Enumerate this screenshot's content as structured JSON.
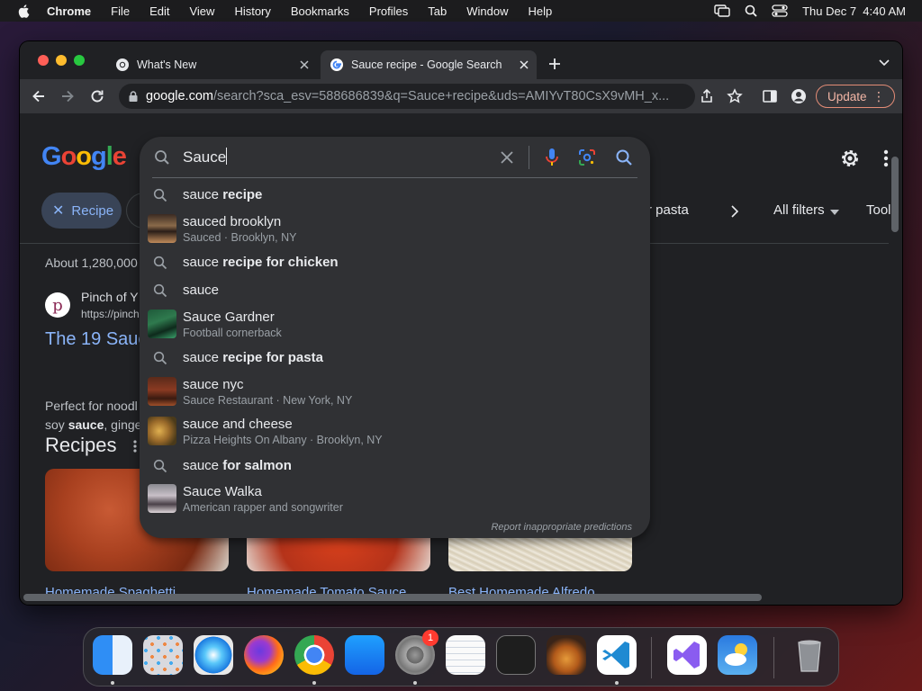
{
  "menubar": {
    "app": "Chrome",
    "items": [
      "File",
      "Edit",
      "View",
      "History",
      "Bookmarks",
      "Profiles",
      "Tab",
      "Window",
      "Help"
    ],
    "clock": "Thu Dec 7  4:40 AM"
  },
  "tabs": [
    {
      "title": "What's New",
      "active": false
    },
    {
      "title": "Sauce recipe - Google Search",
      "active": true
    }
  ],
  "omnibox": {
    "host": "google.com",
    "path": "/search?sca_esv=588686839&q=Sauce+recipe&uds=AMIYvT80CsX9vMH_x..."
  },
  "update_button": "Update",
  "page": {
    "logo": [
      "G",
      "o",
      "o",
      "g",
      "l",
      "e"
    ],
    "logo_colors": [
      "#4285f4",
      "#ea4335",
      "#fbbc05",
      "#4285f4",
      "#34a853",
      "#ea4335"
    ],
    "chip_recipe": "Recipe",
    "filter_partial": "r pasta",
    "all_filters": "All filters",
    "tools_partial": "Tool",
    "about": "About 1,280,000",
    "site_letter": "p",
    "site_name": "Pinch of Y",
    "site_url": "https://pinch",
    "result_title": "The 19 Sauc",
    "snippet_line1": "Perfect for noodl",
    "snippet_line2_a": "soy ",
    "snippet_line2_b": "sauce",
    "snippet_line2_c": ", ginge",
    "recipes_heading": "Recipes",
    "cards": [
      {
        "title": "Homemade Spaghetti"
      },
      {
        "title": "Homemade Tomato Sauce"
      },
      {
        "title": "Best Homemade Alfredo"
      }
    ]
  },
  "search": {
    "query": "Sauce",
    "suggestions": [
      {
        "kind": "query",
        "prefix": "sauce ",
        "bold": "recipe",
        "sub": ""
      },
      {
        "kind": "entity",
        "prefix": "sauced brooklyn",
        "bold": "",
        "sub": "Sauced · Brooklyn, NY"
      },
      {
        "kind": "query",
        "prefix": "sauce ",
        "bold": "recipe for chicken",
        "sub": ""
      },
      {
        "kind": "query",
        "prefix": "sauce",
        "bold": "",
        "sub": ""
      },
      {
        "kind": "entity",
        "prefix": "Sauce Gardner",
        "bold": "",
        "sub": "Football cornerback"
      },
      {
        "kind": "query",
        "prefix": "sauce ",
        "bold": "recipe for pasta",
        "sub": ""
      },
      {
        "kind": "entity",
        "prefix": "sauce nyc",
        "bold": "",
        "sub": "Sauce Restaurant · New York, NY"
      },
      {
        "kind": "entity",
        "prefix": "sauce and cheese",
        "bold": "",
        "sub": "Pizza Heights On Albany · Brooklyn, NY"
      },
      {
        "kind": "query",
        "prefix": "sauce ",
        "bold": "for salmon",
        "sub": ""
      },
      {
        "kind": "entity",
        "prefix": "Sauce Walka",
        "bold": "",
        "sub": "American rapper and songwriter"
      }
    ],
    "report": "Report inappropriate predictions"
  },
  "dock": {
    "apps": [
      "finder-icon",
      "launchpad-icon",
      "safari-icon",
      "firefox-icon",
      "chrome-icon",
      "app-store-icon",
      "system-settings-icon",
      "textedit-icon",
      "terminal-icon",
      "garageband-icon",
      "vscode-icon",
      "visual-studio-icon",
      "weather-icon",
      "trash-icon"
    ],
    "settings_badge": "1"
  }
}
